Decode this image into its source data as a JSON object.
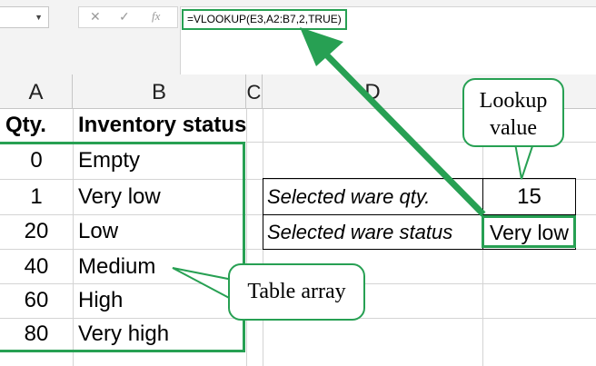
{
  "formula_bar": {
    "cancel_symbol": "✕",
    "enter_symbol": "✓",
    "fx_symbol": "fx",
    "formula": "=VLOOKUP(E3,A2:B7,2,TRUE)"
  },
  "columns": [
    "A",
    "B",
    "C",
    "D"
  ],
  "table": {
    "headers": [
      "Qty.",
      "Inventory status"
    ],
    "rows": [
      {
        "qty": "0",
        "status": "Empty"
      },
      {
        "qty": "1",
        "status": "Very low"
      },
      {
        "qty": "20",
        "status": "Low"
      },
      {
        "qty": "40",
        "status": "Medium"
      },
      {
        "qty": "60",
        "status": "High"
      },
      {
        "qty": "80",
        "status": "Very high"
      }
    ]
  },
  "lookup": {
    "qty_label": "Selected ware qty.",
    "qty_value": "15",
    "status_label": "Selected ware status",
    "status_value": "Very low"
  },
  "callouts": {
    "lookup_value_line1": "Lookup",
    "lookup_value_line2": "value",
    "table_array": "Table array"
  },
  "colors": {
    "accent": "#27a053"
  }
}
